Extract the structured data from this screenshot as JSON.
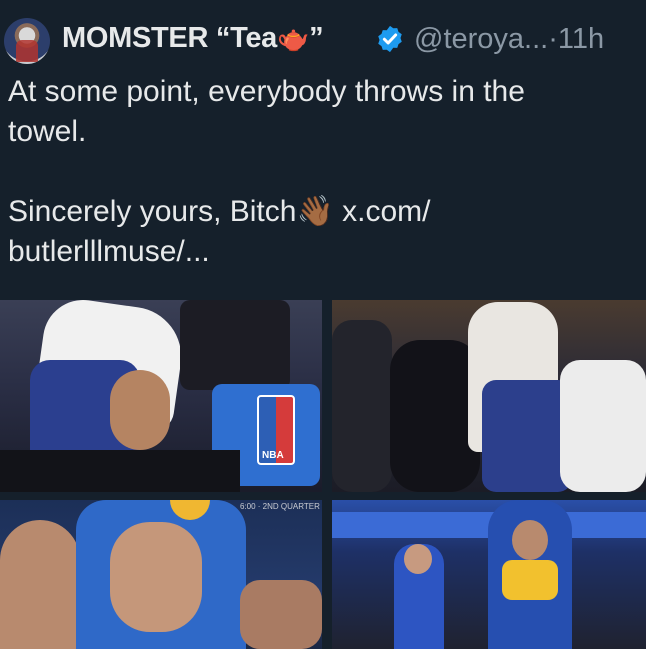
{
  "tweet": {
    "display_name": "MOMSTER “Tea",
    "display_name_suffix": "”",
    "name_emoji": "🫖",
    "handle": "@teroya...",
    "separator": "·",
    "time": "11h",
    "text_line1": "At some point, everybody throws in the",
    "text_line2": "towel.",
    "text_line3": "Sincerely yours, Bitch",
    "text_emoji": "👋🏾",
    "link_part1": "x.com/",
    "link_part2": "butlerlllmuse/..."
  },
  "media": {
    "photo3_caption": "6:00 · 2ND QUARTER",
    "nba_label": "NBA"
  },
  "colors": {
    "background": "#15202b",
    "text": "#e7e9ea",
    "muted": "#8b98a5",
    "verified": "#1d9bf0"
  },
  "icons": {
    "verified": "verified-badge-icon",
    "avatar": "avatar"
  }
}
